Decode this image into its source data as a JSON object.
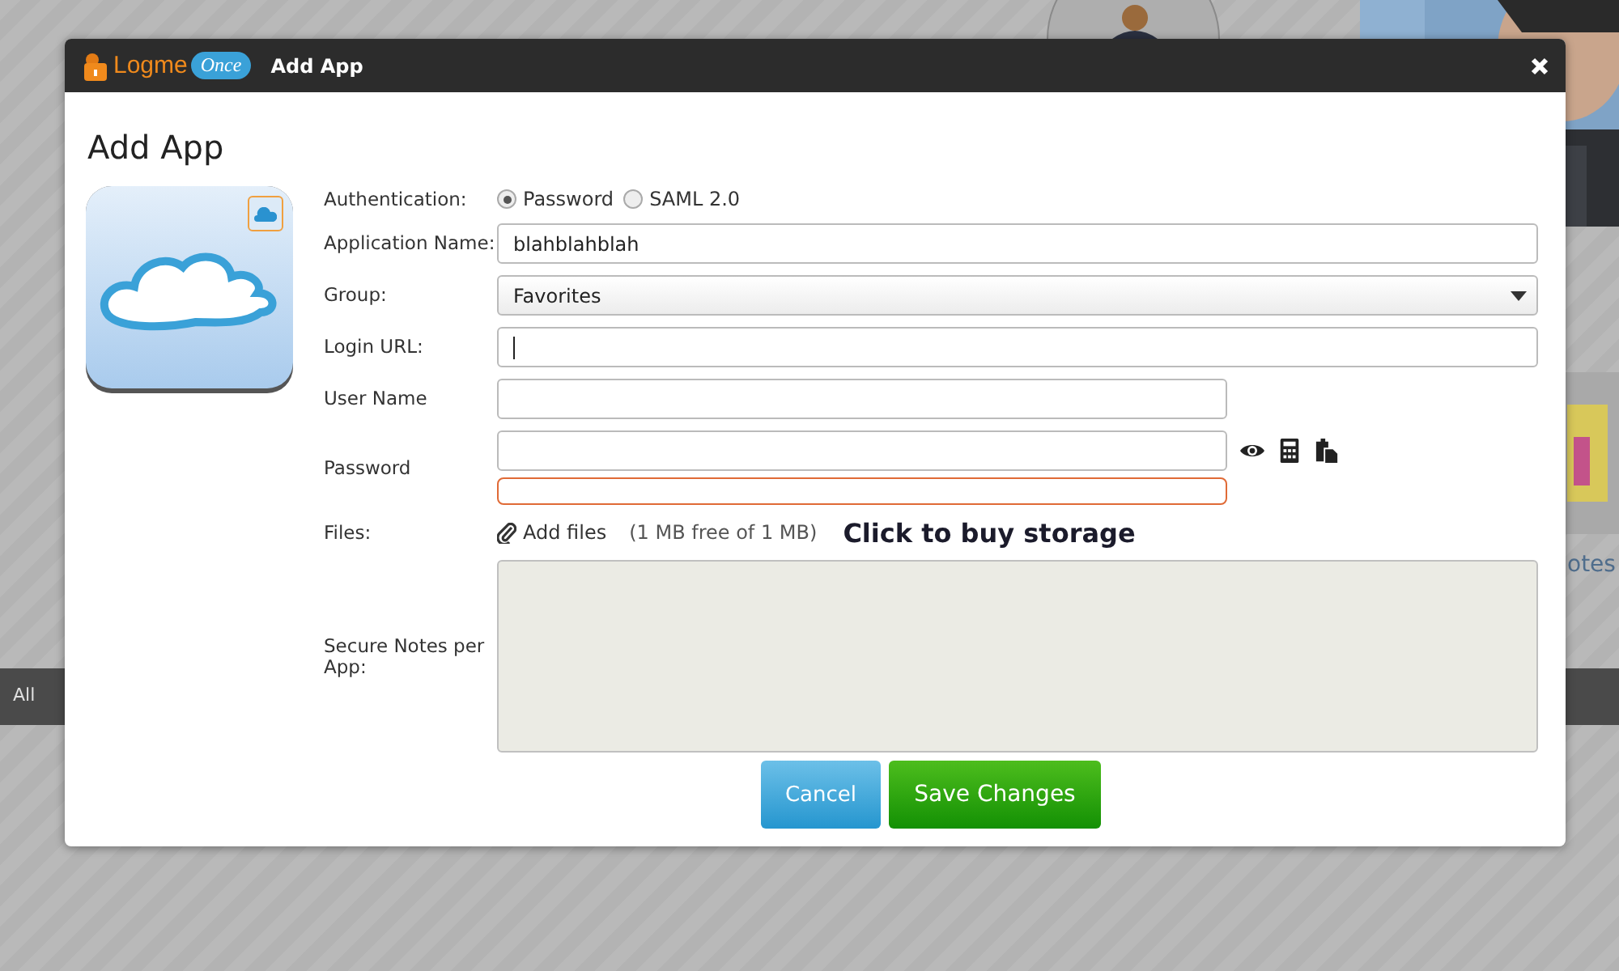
{
  "background": {
    "footer": "All",
    "side_label": "otes"
  },
  "dialog": {
    "logo": {
      "part_1": "Logme",
      "part_2": "Once"
    },
    "title": "Add App",
    "heading": "Add App",
    "fields": [
      {
        "kind": "radio",
        "label": "Authentication:",
        "options": [
          {
            "label": "Password",
            "selected": true
          },
          {
            "label": "SAML 2.0",
            "selected": false
          }
        ]
      },
      {
        "kind": "text",
        "label": "Application Name:",
        "value": "blahblahblah",
        "focused": false
      },
      {
        "kind": "select",
        "label": "Group:",
        "value": "Favorites"
      },
      {
        "kind": "text",
        "label": "Login URL:",
        "focused": true
      },
      {
        "kind": "short",
        "label": "User Name"
      },
      {
        "kind": "password",
        "label": "Password"
      },
      {
        "kind": "files",
        "label": "Files:",
        "link": "Add files",
        "quota": "(1 MB free of 1 MB)",
        "buy": "Click to buy storage"
      },
      {
        "kind": "textarea",
        "label": "Secure Notes per App:"
      }
    ],
    "buttons": [
      {
        "label": "Cancel",
        "kind": "secondary"
      },
      {
        "label": "Save Changes",
        "kind": "primary"
      }
    ]
  }
}
